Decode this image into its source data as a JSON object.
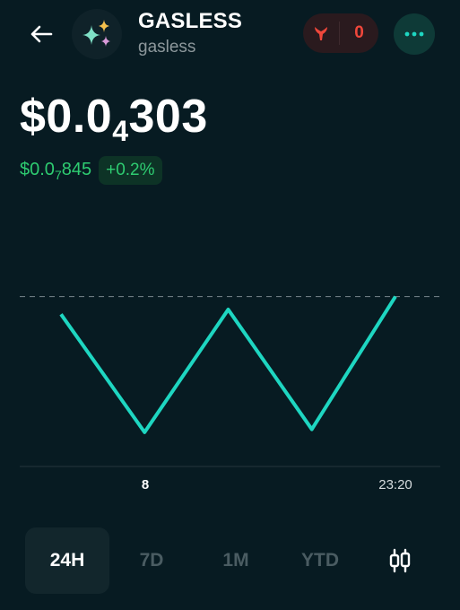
{
  "token": {
    "name": "GASLESS",
    "symbol": "gasless",
    "avatar_icon": "sparkles-icon"
  },
  "header": {
    "back_icon": "arrow-left-icon",
    "fire_icon": "flame-icon",
    "fire_count": "0",
    "more_icon": "more-dots-icon"
  },
  "price": {
    "main_prefix": "$0.0",
    "main_sub": "4",
    "main_suffix": "303",
    "change_prefix": "$0.0",
    "change_sub": "7",
    "change_suffix": "845",
    "change_percent": "+0.2%"
  },
  "chart_data": {
    "type": "line",
    "x_ticks": [
      "8",
      "23:20"
    ],
    "values": [
      0.84,
      0.64,
      0.848,
      0.645,
      0.87
    ],
    "reference_value": 0.87,
    "ylim": [
      0.62,
      0.88
    ],
    "line_color": "#1ed6c1"
  },
  "tabs": [
    {
      "label": "24H",
      "active": true
    },
    {
      "label": "7D",
      "active": false
    },
    {
      "label": "1M",
      "active": false
    },
    {
      "label": "YTD",
      "active": false
    }
  ],
  "chart_type_icon": "candlestick-icon",
  "colors": {
    "background": "#071b22",
    "positive": "#2ecc71",
    "negative": "#f0473b",
    "accent": "#1ed6c1"
  }
}
